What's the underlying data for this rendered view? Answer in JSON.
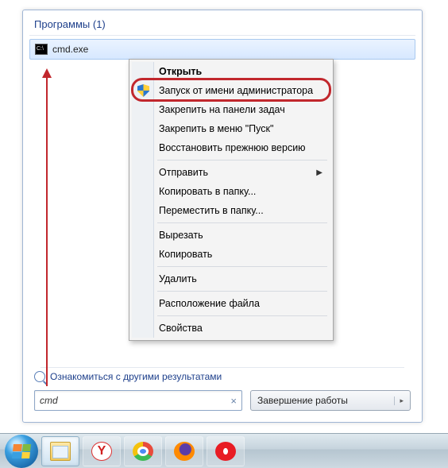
{
  "section": {
    "title": "Программы",
    "count": "(1)"
  },
  "result": {
    "label": "cmd.exe"
  },
  "context_menu": {
    "open": "Открыть",
    "run_admin": "Запуск от имени администратора",
    "pin_taskbar": "Закрепить на панели задач",
    "pin_start": "Закрепить в меню \"Пуск\"",
    "restore_prev": "Восстановить прежнюю версию",
    "send_to": "Отправить",
    "copy_to": "Копировать в папку...",
    "move_to": "Переместить в папку...",
    "cut": "Вырезать",
    "copy": "Копировать",
    "delete": "Удалить",
    "open_location": "Расположение файла",
    "properties": "Свойства"
  },
  "more_results": "Ознакомиться с другими результатами",
  "search": {
    "value": "cmd",
    "clear": "×"
  },
  "shutdown": {
    "label": "Завершение работы",
    "arrow": "▸"
  }
}
